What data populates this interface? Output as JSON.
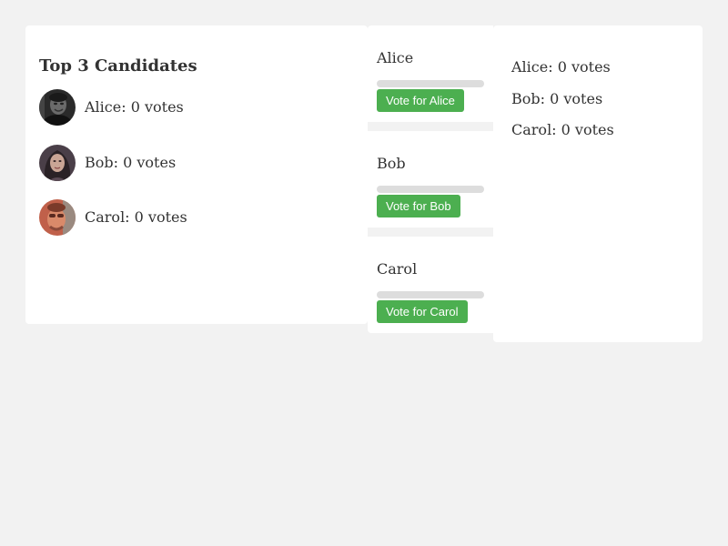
{
  "leaderboard": {
    "title": "Top 3 Candidates",
    "entries": [
      {
        "text": "Alice: 0 votes",
        "avatar_icon": "avatar-alice-photo"
      },
      {
        "text": "Bob: 0 votes",
        "avatar_icon": "avatar-bob-photo"
      },
      {
        "text": "Carol: 0 votes",
        "avatar_icon": "avatar-carol-photo"
      }
    ]
  },
  "voting": {
    "cards": [
      {
        "name": "Alice",
        "progress": 0,
        "button_label": "Vote for Alice"
      },
      {
        "name": "Bob",
        "progress": 0,
        "button_label": "Vote for Bob"
      },
      {
        "name": "Carol",
        "progress": 0,
        "button_label": "Vote for Carol"
      }
    ]
  },
  "tally": {
    "lines": [
      "Alice: 0 votes",
      "Bob: 0 votes",
      "Carol: 0 votes"
    ]
  },
  "colors": {
    "background": "#f2f2f2",
    "panel": "#ffffff",
    "button": "#4caf50",
    "progress_track": "#dddddd",
    "text": "#333333"
  }
}
